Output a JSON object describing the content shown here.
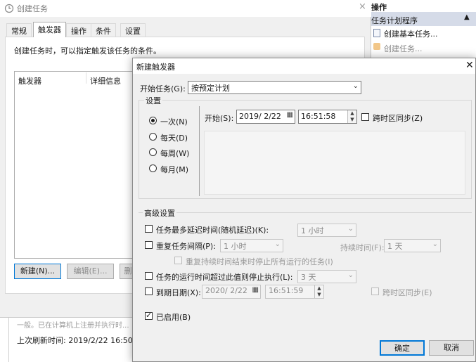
{
  "background_window": {
    "title": "创建任务",
    "close_glyph": "×",
    "tabs": [
      "常规",
      "触发器",
      "操作",
      "条件",
      "设置"
    ],
    "active_tab_index": 1,
    "description": "创建任务时，可以指定触发该任务的条件。",
    "table_columns": [
      "触发器",
      "详细信息"
    ],
    "buttons": {
      "new": "新建(N)...",
      "edit": "编辑(E)...",
      "delete": "删"
    },
    "lower_text": "一般。已在计算机上注册并执行时...",
    "last_refresh": "上次刷新时间: 2019/2/22 16:50:01"
  },
  "actions_pane": {
    "header": "操作",
    "group_label": "任务计划程序",
    "group_arrow": "▲",
    "items": [
      "创建基本任务...",
      "创建任务..."
    ]
  },
  "dialog": {
    "title": "新建触发器",
    "close_glyph": "✕",
    "begin_task_label": "开始任务(G):",
    "begin_task_value": "按预定计划",
    "settings_label": "设置",
    "schedule_options": [
      "一次(N)",
      "每天(D)",
      "每周(W)",
      "每月(M)"
    ],
    "selected_schedule_index": 0,
    "start_label": "开始(S):",
    "start_date": "2019/ 2/22",
    "start_time": "16:51:58",
    "sync_timezone_label": "跨时区同步(Z)",
    "advanced_label": "高级设置",
    "delay_label": "任务最多延迟时间(随机延迟)(K):",
    "delay_value": "1 小时",
    "repeat_label": "重复任务间隔(P):",
    "repeat_value": "1 小时",
    "duration_label": "持续时间(F):",
    "duration_value": "1 天",
    "stop_at_end_label": "重复持续时间结束时停止所有运行的任务(I)",
    "stop_if_longer_label": "任务的运行时间超过此值则停止执行(L):",
    "stop_if_longer_value": "3 天",
    "expire_label": "到期日期(X):",
    "expire_date": "2020/ 2/22",
    "expire_time": "16:51:59",
    "expire_sync_label": "跨时区同步(E)",
    "enabled_label": "已启用(B)",
    "enabled_checked": true,
    "ok_label": "确定",
    "cancel_label": "取消"
  },
  "icons": {
    "dropdown": "⌄",
    "calendar": "▦",
    "spin_up": "▲",
    "spin_down": "▼"
  },
  "colors": {
    "accent": "#0078d7",
    "pane_group": "#d5dbe8"
  }
}
